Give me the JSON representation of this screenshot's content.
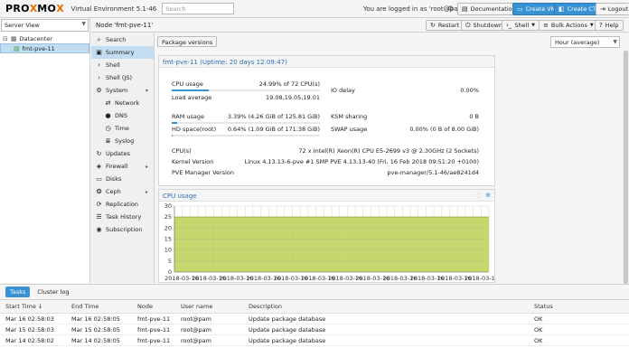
{
  "header": {
    "logo_text": "PROXMOX",
    "version": "Virtual Environment 5.1-46",
    "search_placeholder": "Search",
    "logged_in": "You are logged in as 'root@pam'",
    "buttons": {
      "documentation": "Documentation",
      "create_vm": "Create VM",
      "create_ct": "Create CT",
      "logout": "Logout"
    }
  },
  "tree": {
    "view": "Server View",
    "items": [
      {
        "label": "Datacenter"
      },
      {
        "label": "fmt-pve-11"
      }
    ]
  },
  "nodebar": {
    "title": "Node 'fmt-pve-11'",
    "buttons": {
      "restart": "Restart",
      "shutdown": "Shutdown",
      "shell": "Shell",
      "bulk": "Bulk Actions",
      "help": "Help"
    }
  },
  "menu": {
    "items": [
      {
        "label": "Search"
      },
      {
        "label": "Summary"
      },
      {
        "label": "Shell"
      },
      {
        "label": "Shell (JS)"
      },
      {
        "label": "System"
      },
      {
        "label": "Network"
      },
      {
        "label": "DNS"
      },
      {
        "label": "Time"
      },
      {
        "label": "Syslog"
      },
      {
        "label": "Updates"
      },
      {
        "label": "Firewall"
      },
      {
        "label": "Disks"
      },
      {
        "label": "Ceph"
      },
      {
        "label": "Replication"
      },
      {
        "label": "Task History"
      },
      {
        "label": "Subscription"
      }
    ]
  },
  "toolbar": {
    "package_versions": "Package versions",
    "timeframe": "Hour (average)"
  },
  "status": {
    "title": "fmt-pve-11 (Uptime: 20 days 12:09:47)",
    "cpu_label": "CPU usage",
    "cpu_value": "24.99% of 72 CPU(s)",
    "cpu_fraction": 0.25,
    "io_label": "IO delay",
    "io_value": "0.00%",
    "load_label": "Load average",
    "load_value": "19.08,19.05,19.01",
    "ram_label": "RAM usage",
    "ram_value": "3.39% (4.26 GiB of 125.81 GiB)",
    "ram_fraction": 0.034,
    "ksm_label": "KSM sharing",
    "ksm_value": "0 B",
    "hd_label": "HD space(root)",
    "hd_value": "0.64% (1.09 GiB of 171.38 GiB)",
    "hd_fraction": 0.0064,
    "swap_label": "SWAP usage",
    "swap_value": "0.00% (0 B of 8.00 GiB)",
    "cpus_label": "CPU(s)",
    "cpus_value": "72 x Intel(R) Xeon(R) CPU E5-2699 v3 @ 2.30GHz (2 Sockets)",
    "kernel_label": "Kernel Version",
    "kernel_value": "Linux 4.13.13-6-pve #1 SMP PVE 4.13.13-40 (Fri, 16 Feb 2018 09:51:20 +0100)",
    "pve_label": "PVE Manager Version",
    "pve_value": "pve-manager/5.1-46/ae8241d4"
  },
  "chart_data": {
    "type": "area",
    "title": "CPU usage",
    "ylim": [
      0,
      30
    ],
    "yticks": [
      0,
      5,
      10,
      15,
      20,
      25,
      30
    ],
    "x": [
      "2018-03-16",
      "2018-03-16",
      "2018-03-16",
      "2018-03-16",
      "2018-03-16",
      "2018-03-16",
      "2018-03-16",
      "2018-03-16",
      "2018-03-16",
      "2018-03-16",
      "2018-03-16",
      "2018-03-16"
    ],
    "series": [
      {
        "values": [
          25,
          25,
          25,
          25,
          25,
          25,
          25,
          25,
          25,
          25,
          25,
          25
        ]
      }
    ],
    "grid": true,
    "color": "#c5d86d",
    "line_color": "#9fb83a"
  },
  "tasks": {
    "tabs": [
      "Tasks",
      "Cluster log"
    ],
    "columns": [
      "Start Time ↓",
      "End Time",
      "Node",
      "User name",
      "Description",
      "Status"
    ],
    "rows": [
      [
        "Mar 16 02:58:03",
        "Mar 16 02:58:05",
        "fmt-pve-11",
        "root@pam",
        "Update package database",
        "OK"
      ],
      [
        "Mar 15 02:58:03",
        "Mar 15 02:58:05",
        "fmt-pve-11",
        "root@pam",
        "Update package database",
        "OK"
      ],
      [
        "Mar 14 02:58:02",
        "Mar 14 02:58:05",
        "fmt-pve-11",
        "root@pam",
        "Update package database",
        "OK"
      ]
    ]
  }
}
